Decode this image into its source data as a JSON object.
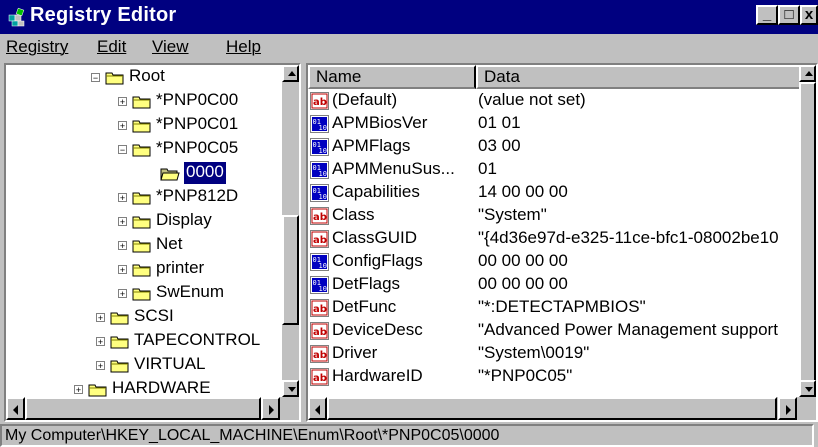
{
  "window": {
    "title": "Registry Editor",
    "controls": {
      "minimize": "_",
      "maximize": "□",
      "close": "x"
    }
  },
  "menu": [
    {
      "label": "Registry"
    },
    {
      "label": "Edit"
    },
    {
      "label": "View"
    },
    {
      "label": "Help"
    }
  ],
  "tree": {
    "items": [
      {
        "label": "Root",
        "expander": "−"
      },
      {
        "label": "*PNP0C00",
        "expander": "+"
      },
      {
        "label": "*PNP0C01",
        "expander": "+"
      },
      {
        "label": "*PNP0C05",
        "expander": "−"
      },
      {
        "label": "0000",
        "expander": "",
        "selected": true
      },
      {
        "label": "*PNP812D",
        "expander": "+"
      },
      {
        "label": "Display",
        "expander": "+"
      },
      {
        "label": "Net",
        "expander": "+"
      },
      {
        "label": "printer",
        "expander": "+"
      },
      {
        "label": "SwEnum",
        "expander": "+"
      },
      {
        "label": "SCSI",
        "expander": "+"
      },
      {
        "label": "TAPECONTROL",
        "expander": "+"
      },
      {
        "label": "VIRTUAL",
        "expander": "+"
      },
      {
        "label": "HARDWARE",
        "expander": "+"
      }
    ]
  },
  "list": {
    "columns": {
      "name": "Name",
      "data": "Data"
    },
    "rows": [
      {
        "icon": "string-value-icon",
        "name": "(Default)",
        "data": "(value not set)"
      },
      {
        "icon": "binary-value-icon",
        "name": "APMBiosVer",
        "data": "01 01"
      },
      {
        "icon": "binary-value-icon",
        "name": "APMFlags",
        "data": "03 00"
      },
      {
        "icon": "binary-value-icon",
        "name": "APMMenuSus...",
        "data": "01"
      },
      {
        "icon": "binary-value-icon",
        "name": "Capabilities",
        "data": "14 00 00 00"
      },
      {
        "icon": "string-value-icon",
        "name": "Class",
        "data": "\"System\""
      },
      {
        "icon": "string-value-icon",
        "name": "ClassGUID",
        "data": "\"{4d36e97d-e325-11ce-bfc1-08002be10"
      },
      {
        "icon": "binary-value-icon",
        "name": "ConfigFlags",
        "data": "00 00 00 00"
      },
      {
        "icon": "binary-value-icon",
        "name": "DetFlags",
        "data": "00 00 00 00"
      },
      {
        "icon": "string-value-icon",
        "name": "DetFunc",
        "data": "\"*:DETECTAPMBIOS\""
      },
      {
        "icon": "string-value-icon",
        "name": "DeviceDesc",
        "data": "\"Advanced Power Management support"
      },
      {
        "icon": "string-value-icon",
        "name": "Driver",
        "data": "\"System\\0019\""
      },
      {
        "icon": "string-value-icon",
        "name": "HardwareID",
        "data": "\"*PNP0C05\""
      }
    ]
  },
  "status": {
    "path": "My Computer\\HKEY_LOCAL_MACHINE\\Enum\\Root\\*PNP0C05\\0000"
  },
  "colors": {
    "title_bar": "#000080",
    "chrome": "#c0c0c0",
    "selection": "#000080"
  }
}
